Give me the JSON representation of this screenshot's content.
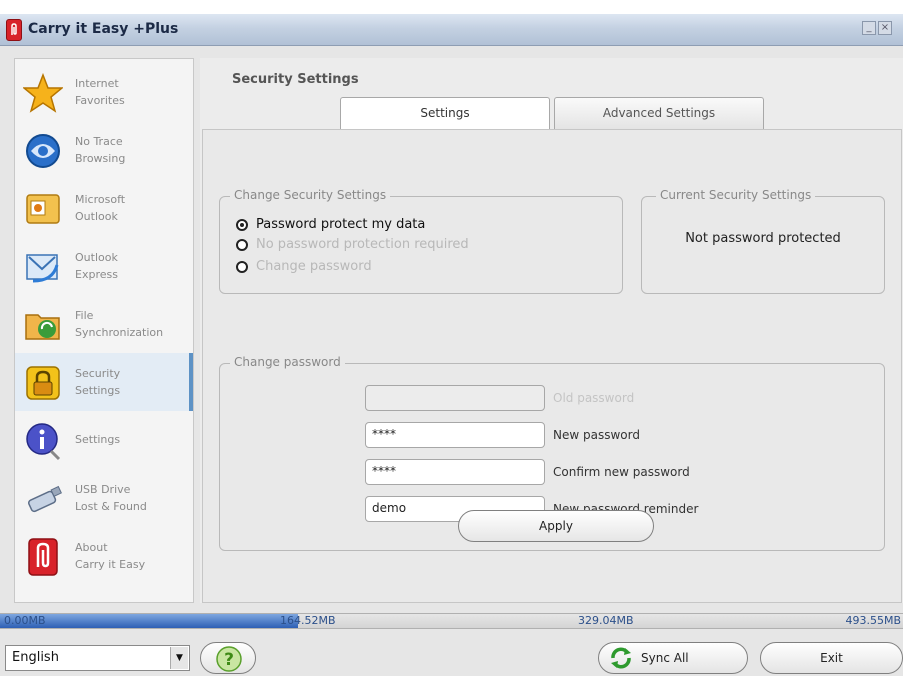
{
  "window": {
    "title": "Carry it Easy +Plus",
    "minimize_label": "_",
    "close_label": "×"
  },
  "sidebar": {
    "items": [
      {
        "label": "Internet\nFavorites"
      },
      {
        "label": "No Trace\nBrowsing"
      },
      {
        "label": "Microsoft\nOutlook"
      },
      {
        "label": "Outlook\nExpress"
      },
      {
        "label": "File\nSynchronization"
      },
      {
        "label": "Security\nSettings"
      },
      {
        "label": "Settings"
      },
      {
        "label": "USB Drive\nLost & Found"
      },
      {
        "label": "About\nCarry it Easy"
      }
    ]
  },
  "main": {
    "title": "Security Settings",
    "tabs": [
      {
        "label": "Settings"
      },
      {
        "label": "Advanced Settings"
      }
    ],
    "change_security": {
      "legend": "Change Security Settings",
      "options": [
        {
          "label": "Password protect my data",
          "checked": true,
          "disabled": false
        },
        {
          "label": "No password protection required",
          "checked": false,
          "disabled": true
        },
        {
          "label": "Change password",
          "checked": false,
          "disabled": true
        }
      ]
    },
    "current_security": {
      "legend": "Current Security Settings",
      "status": "Not password protected"
    },
    "change_password": {
      "legend": "Change password",
      "fields": [
        {
          "label": "Old password",
          "value": "",
          "disabled": true
        },
        {
          "label": "New password",
          "value": "****",
          "disabled": false
        },
        {
          "label": "Confirm new password",
          "value": "****",
          "disabled": false
        },
        {
          "label": "New password reminder",
          "value": "demo",
          "disabled": false
        }
      ],
      "apply_label": "Apply"
    }
  },
  "storage": {
    "ticks": [
      "0.00MB",
      "164.52MB",
      "329.04MB",
      "493.55MB"
    ],
    "used_fraction": 0.33
  },
  "bottom": {
    "language": "English",
    "help_label": "?",
    "sync_label": "Sync All",
    "exit_label": "Exit"
  },
  "colors": {
    "accent": "#5d92c5",
    "title_gradient": "#c4d1e2",
    "progress_fill": "#2d5fb4"
  }
}
